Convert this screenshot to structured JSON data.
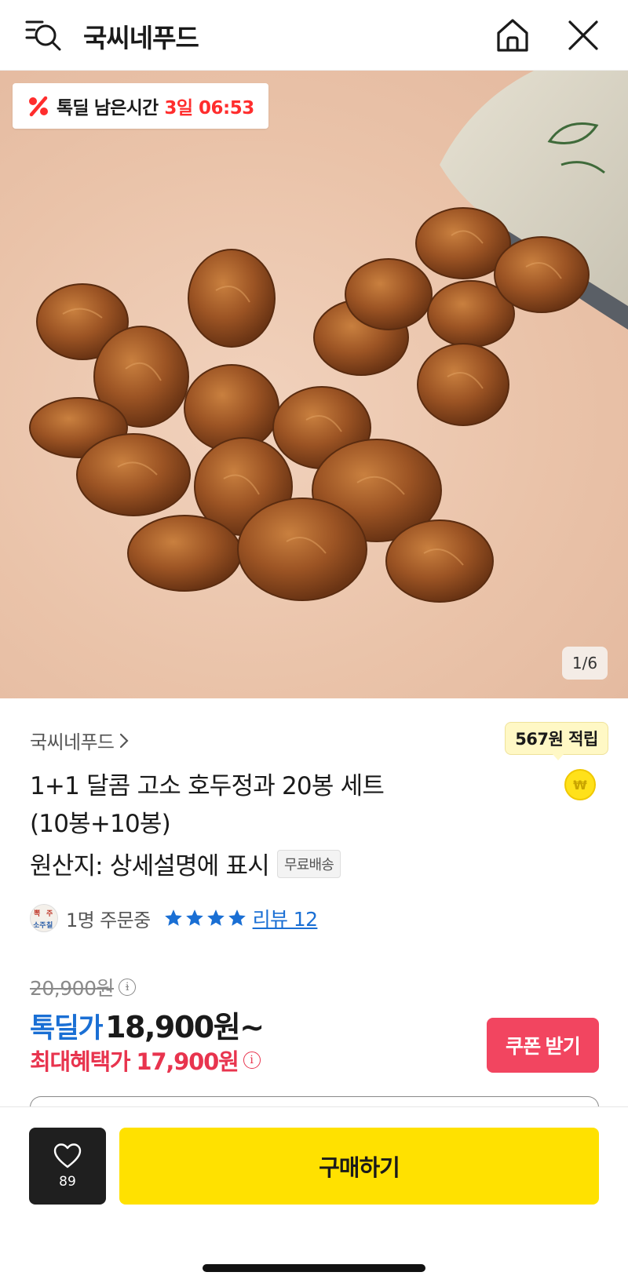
{
  "header": {
    "title": "국씨네푸드",
    "menu_search_icon": "menu-search-icon",
    "home_icon": "home-icon",
    "close_icon": "close-icon"
  },
  "hero": {
    "timer_label": "톡딜 남은시간",
    "timer_value": "3일 06:53",
    "page_indicator": "1/6"
  },
  "product": {
    "seller": "국씨네푸드",
    "points": "567원 적립",
    "coin_symbol": "₩",
    "title_line1": "1+1 달콤 고소 호두정과 20봉 세트",
    "title_line2": "(10봉+10봉)",
    "origin": "원산지: 상세설명에 표시",
    "shipping_badge": "무료배송",
    "orders": "1명 주문중",
    "star_count": 4,
    "review_label": "리뷰 12"
  },
  "price": {
    "original": "20,900원",
    "deal_label": "톡딜가",
    "deal_price": "18,900원~",
    "max_label": "최대혜택가",
    "max_price": "17,900원",
    "info_glyph": "i",
    "coupon_button": "쿠폰 받기"
  },
  "bottom_bar": {
    "like_count": "89",
    "buy_button": "구매하기"
  },
  "colors": {
    "accent_yellow": "#ffe100",
    "deal_blue": "#1a6fd4",
    "benefit_red": "#e8344e",
    "coupon_red": "#f24560",
    "timer_red": "#ff2d2d"
  }
}
